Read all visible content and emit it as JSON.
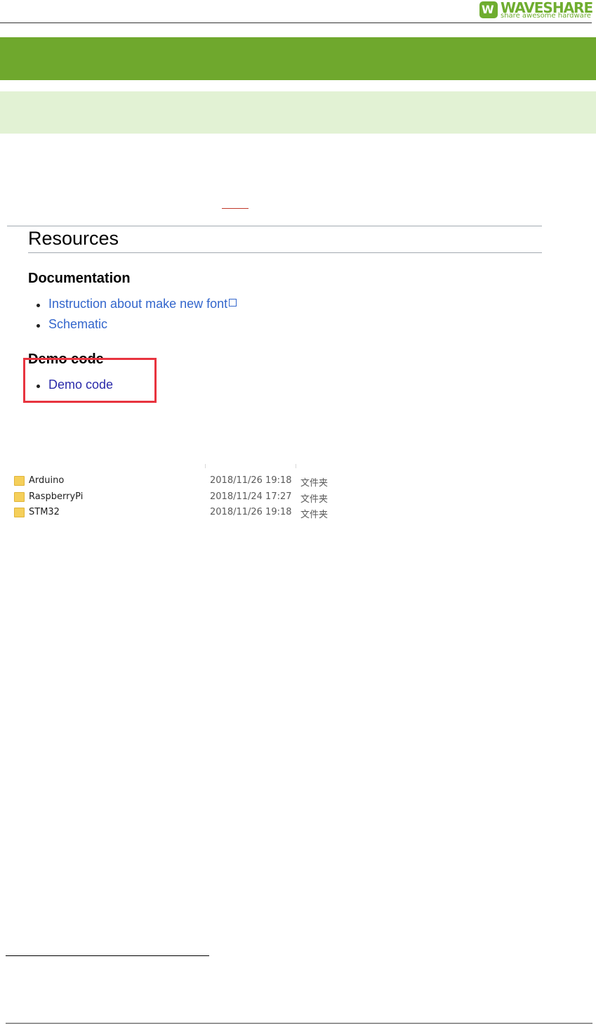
{
  "header": {
    "logo": {
      "brand": "WAVESHARE",
      "tagline": "share awesome hardware",
      "color": "#6fad2f"
    }
  },
  "colors": {
    "section_bar": "#6fa82d",
    "subsection_bar": "#e2f2d4",
    "highlight_box": "#e8343f",
    "link": "#3366cc"
  },
  "wiki": {
    "title": "Resources",
    "sections": [
      {
        "heading": "Documentation",
        "items": [
          {
            "label": "Instruction about make new font",
            "external": true
          },
          {
            "label": "Schematic",
            "external": false
          }
        ]
      },
      {
        "heading": "Demo code",
        "items": [
          {
            "label": "Demo code",
            "external": false
          }
        ]
      }
    ]
  },
  "files": [
    {
      "name": "Arduino",
      "modified": "2018/11/26 19:18",
      "type": "文件夹",
      "icon": "folder-icon"
    },
    {
      "name": "RaspberryPi",
      "modified": "2018/11/24 17:27",
      "type": "文件夹",
      "icon": "folder-icon"
    },
    {
      "name": "STM32",
      "modified": "2018/11/26 19:18",
      "type": "文件夹",
      "icon": "folder-icon"
    }
  ]
}
